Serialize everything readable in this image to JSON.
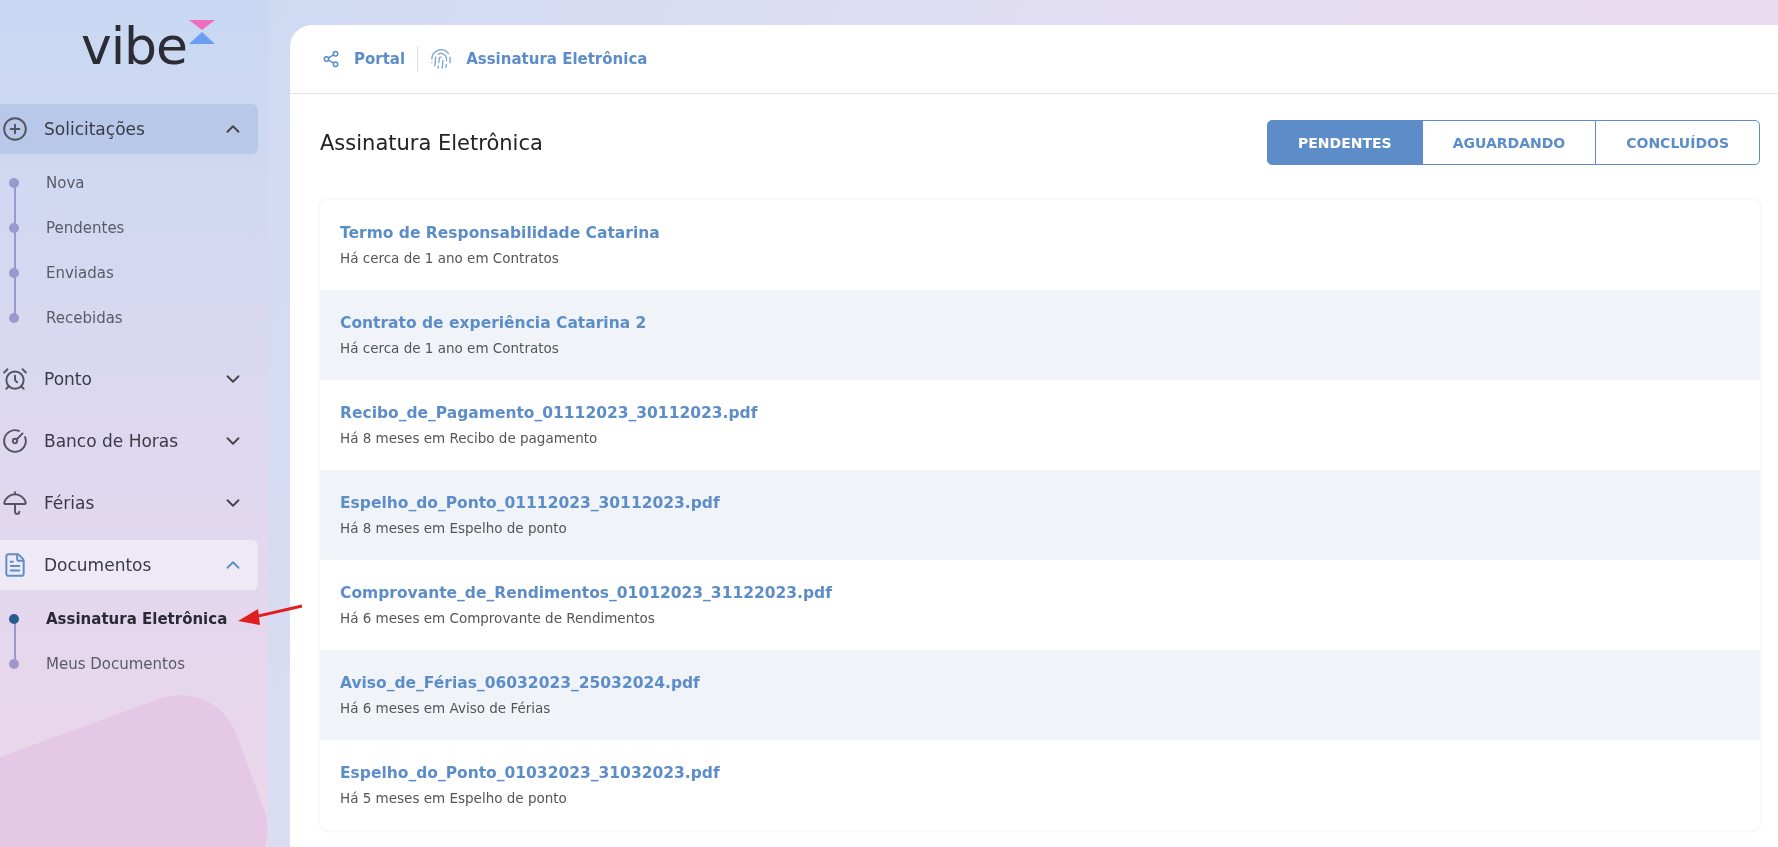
{
  "logo": {
    "text": "vibe"
  },
  "sidebar": {
    "groups": [
      {
        "label": "Solicitações",
        "expanded": true,
        "selected": false,
        "children": [
          {
            "label": "Nova",
            "selected": false
          },
          {
            "label": "Pendentes",
            "selected": false
          },
          {
            "label": "Enviadas",
            "selected": false
          },
          {
            "label": "Recebidas",
            "selected": false
          }
        ]
      },
      {
        "label": "Ponto",
        "expanded": false,
        "selected": false
      },
      {
        "label": "Banco de Horas",
        "expanded": false,
        "selected": false
      },
      {
        "label": "Férias",
        "expanded": false,
        "selected": false
      },
      {
        "label": "Documentos",
        "expanded": true,
        "selected": true,
        "children": [
          {
            "label": "Assinatura Eletrônica",
            "selected": true
          },
          {
            "label": "Meus Documentos",
            "selected": false
          }
        ]
      }
    ]
  },
  "breadcrumb": [
    "Portal",
    "Assinatura Eletrônica"
  ],
  "page_title": "Assinatura Eletrônica",
  "tabs": [
    {
      "label": "PENDENTES",
      "selected": true
    },
    {
      "label": "AGUARDANDO",
      "selected": false
    },
    {
      "label": "CONCLUÍDOS",
      "selected": false
    }
  ],
  "documents": [
    {
      "title": "Termo de Responsabilidade Catarina",
      "subtitle": "Há cerca de 1 ano em Contratos"
    },
    {
      "title": "Contrato de experiência Catarina 2",
      "subtitle": "Há cerca de 1 ano em Contratos"
    },
    {
      "title": "Recibo_de_Pagamento_01112023_30112023.pdf",
      "subtitle": "Há 8 meses em Recibo de pagamento"
    },
    {
      "title": "Espelho_do_Ponto_01112023_30112023.pdf",
      "subtitle": "Há 8 meses em Espelho de ponto"
    },
    {
      "title": "Comprovante_de_Rendimentos_01012023_31122023.pdf",
      "subtitle": "Há 6 meses em Comprovante de Rendimentos"
    },
    {
      "title": "Aviso_de_Férias_06032023_25032024.pdf",
      "subtitle": "Há 6 meses em Aviso de Férias"
    },
    {
      "title": "Espelho_do_Ponto_01032023_31032023.pdf",
      "subtitle": "Há 5 meses em Espelho de ponto"
    }
  ]
}
